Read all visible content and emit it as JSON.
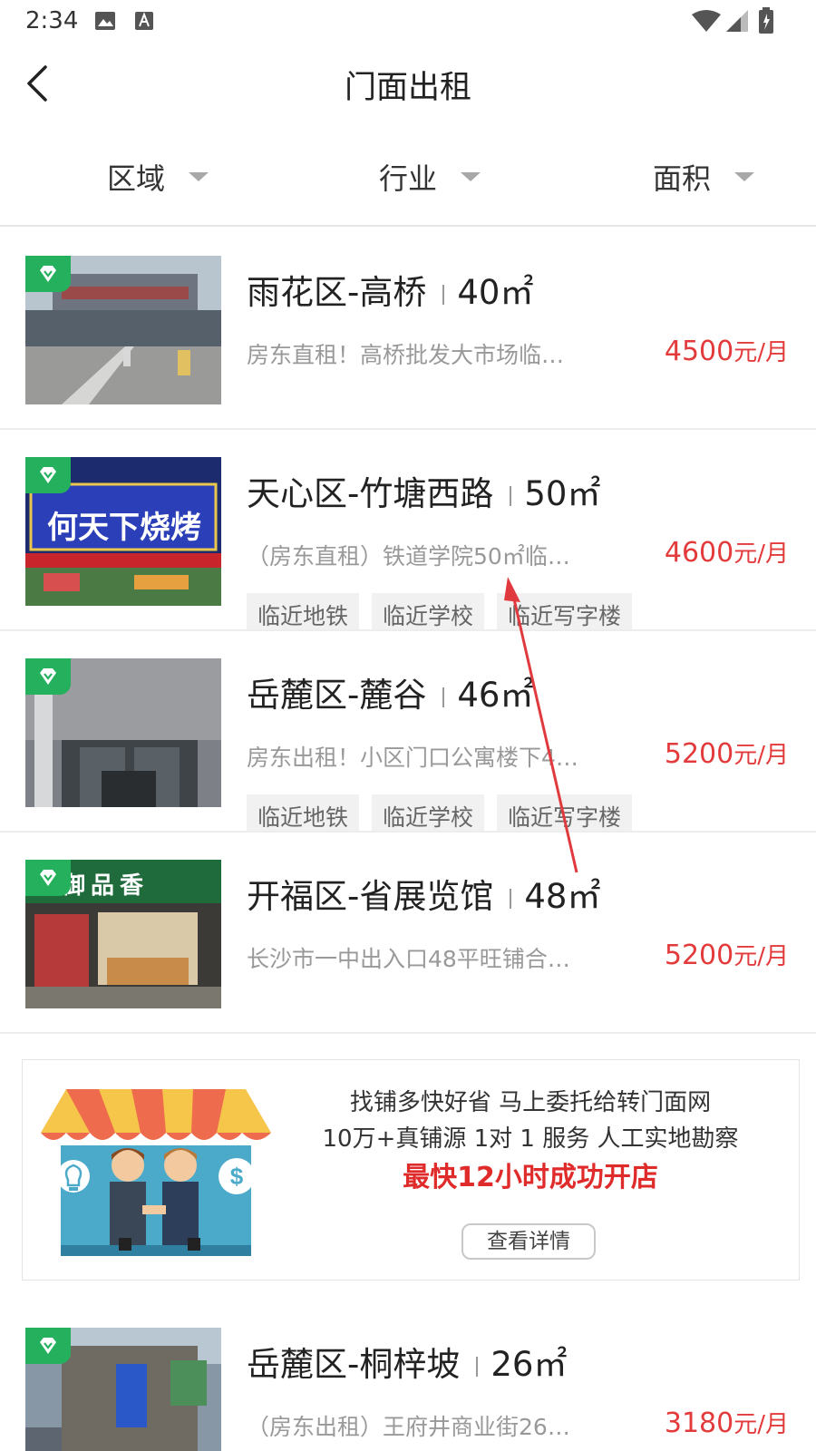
{
  "status_bar": {
    "time": "2:34",
    "icons": [
      "image-icon",
      "a-icon",
      "wifi-icon",
      "signal-icon",
      "battery-icon"
    ]
  },
  "header": {
    "title": "门面出租",
    "back_icon": "chevron-left-icon"
  },
  "filters": [
    {
      "label": "区域",
      "icon": "caret-down-icon"
    },
    {
      "label": "行业",
      "icon": "caret-down-icon"
    },
    {
      "label": "面积",
      "icon": "caret-down-icon"
    }
  ],
  "listings": [
    {
      "district": "雨花区-高桥",
      "area": "40㎡",
      "desc": "房东直租！高桥批发大市场临…",
      "price": "4500",
      "unit": "元/月",
      "tags": [],
      "badge_icon": "verified-icon"
    },
    {
      "district": "天心区-竹塘西路",
      "area": "50㎡",
      "desc": "（房东直租）铁道学院50㎡临…",
      "price": "4600",
      "unit": "元/月",
      "tags": [
        "临近地铁",
        "临近学校",
        "临近写字楼"
      ],
      "badge_icon": "verified-icon",
      "sign_text": "何天下烧烤"
    },
    {
      "district": "岳麓区-麓谷",
      "area": "46㎡",
      "desc": "房东出租！小区门口公寓楼下4…",
      "price": "5200",
      "unit": "元/月",
      "tags": [
        "临近地铁",
        "临近学校",
        "临近写字楼"
      ],
      "badge_icon": "verified-icon"
    },
    {
      "district": "开福区-省展览馆",
      "area": "48㎡",
      "desc": "长沙市一中出入口48平旺铺合…",
      "price": "5200",
      "unit": "元/月",
      "tags": [],
      "badge_icon": "verified-icon",
      "sign_text": "御品香"
    },
    {
      "district": "岳麓区-桐梓坡",
      "area": "26㎡",
      "desc": "（房东出租）王府井商业街26…",
      "price": "3180",
      "unit": "元/月",
      "tags": [],
      "badge_icon": "verified-icon"
    }
  ],
  "banner": {
    "line1": "找铺多快好省 马上委托给转门面网",
    "line2": "10万+真铺源 1对 1 服务 人工实地勘察",
    "line3": "最快12小时成功开店",
    "button": "查看详情",
    "art_icons": [
      "handshake-icon",
      "lightbulb-icon",
      "dollar-icon"
    ]
  },
  "colors": {
    "price": "#e33b3b",
    "badge": "#25b05e",
    "divider": "#ededed",
    "tag_bg": "#f1f1f1",
    "annotation_arrow": "#e0393e"
  }
}
